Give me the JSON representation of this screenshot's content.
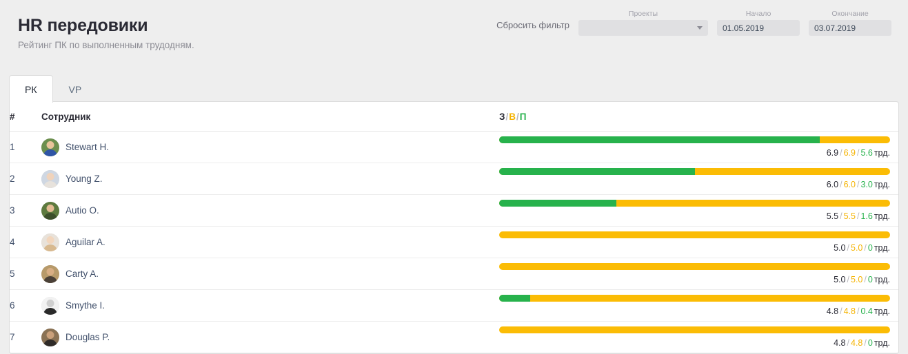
{
  "header": {
    "title": "HR передовики",
    "subtitle": "Рейтинг ПК по выполненным трудодням.",
    "reset_filter_label": "Сбросить фильтр",
    "projects": {
      "label": "Проекты",
      "value": "",
      "placeholder": ""
    },
    "date_start": {
      "label": "Начало",
      "value": "01.05.2019"
    },
    "date_end": {
      "label": "Окончание",
      "value": "03.07.2019"
    }
  },
  "tabs": [
    {
      "label": "РК",
      "active": true
    },
    {
      "label": "VP",
      "active": false
    }
  ],
  "table": {
    "columns": {
      "rank": "#",
      "employee": "Сотрудник",
      "stats_z": "З",
      "stats_sep": "/",
      "stats_v": "В",
      "stats_p": "П"
    },
    "unit": "трд.",
    "rows": [
      {
        "rank": "1",
        "name": "Stewart H.",
        "z": "6.9",
        "v": "6.9",
        "p": "5.6",
        "green_pct": 82,
        "avatar": {
          "bg": "#6c8f4e",
          "head": "#e8c49a",
          "body": "#2f55a6"
        }
      },
      {
        "rank": "2",
        "name": "Young Z.",
        "z": "6.0",
        "v": "6.0",
        "p": "3.0",
        "green_pct": 50,
        "avatar": {
          "bg": "#cfd7e2",
          "head": "#f0d3bb",
          "body": "#e7e2dc"
        }
      },
      {
        "rank": "3",
        "name": "Autio O.",
        "z": "5.5",
        "v": "5.5",
        "p": "1.6",
        "green_pct": 30,
        "avatar": {
          "bg": "#5d7a3e",
          "head": "#e3bb93",
          "body": "#3c4f2b"
        }
      },
      {
        "rank": "4",
        "name": "Aguilar A.",
        "z": "5.0",
        "v": "5.0",
        "p": "0",
        "green_pct": 0,
        "avatar": {
          "bg": "#e8e2da",
          "head": "#f2d6bd",
          "body": "#d8b98f"
        }
      },
      {
        "rank": "5",
        "name": "Carty A.",
        "z": "5.0",
        "v": "5.0",
        "p": "0",
        "green_pct": 0,
        "avatar": {
          "bg": "#b79a6a",
          "head": "#d8ae84",
          "body": "#4a4037"
        }
      },
      {
        "rank": "6",
        "name": "Smythe I.",
        "z": "4.8",
        "v": "4.8",
        "p": "0.4",
        "green_pct": 8,
        "avatar": {
          "bg": "#f2f2f2",
          "head": "#cfcfcf",
          "body": "#2a2a2a"
        }
      },
      {
        "rank": "7",
        "name": "Douglas P.",
        "z": "4.8",
        "v": "4.8",
        "p": "0",
        "green_pct": 0,
        "avatar": {
          "bg": "#8a7254",
          "head": "#caa07a",
          "body": "#2f2b28"
        }
      }
    ]
  },
  "colors": {
    "green": "#27b24c",
    "yellow": "#fbbc05",
    "page_bg": "#eeeeee",
    "card_bg": "#ffffff"
  }
}
